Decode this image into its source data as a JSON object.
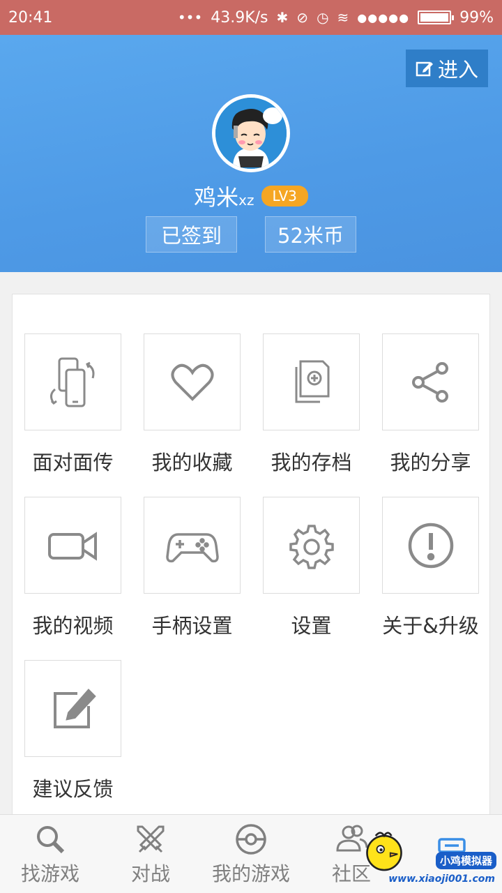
{
  "status_bar": {
    "time": "20:41",
    "more": "•••",
    "speed": "43.9K/s",
    "battery_text": "99%"
  },
  "header": {
    "enter_label": "进入",
    "username": "鸡米",
    "username_suffix": "xz",
    "level": "LV3",
    "signed_label": "已签到",
    "coins_label": "52米币"
  },
  "grid": [
    {
      "label": "面对面传",
      "icon": "phone-transfer-icon"
    },
    {
      "label": "我的收藏",
      "icon": "heart-icon"
    },
    {
      "label": "我的存档",
      "icon": "save-file-icon"
    },
    {
      "label": "我的分享",
      "icon": "share-icon"
    },
    {
      "label": "我的视频",
      "icon": "video-camera-icon"
    },
    {
      "label": "手柄设置",
      "icon": "gamepad-icon"
    },
    {
      "label": "设置",
      "icon": "gear-icon"
    },
    {
      "label": "关于&升级",
      "icon": "info-exclamation-icon"
    },
    {
      "label": "建议反馈",
      "icon": "edit-feedback-icon"
    }
  ],
  "bottom_nav": [
    {
      "label": "找游戏",
      "icon": "search-icon"
    },
    {
      "label": "对战",
      "icon": "swords-icon"
    },
    {
      "label": "我的游戏",
      "icon": "pokeball-icon"
    },
    {
      "label": "社区",
      "icon": "users-icon"
    },
    {
      "label": "",
      "icon": "server-icon"
    }
  ],
  "watermark": {
    "name": "小鸡模拟器",
    "url": "www.xiaoji001.com"
  },
  "colors": {
    "status_bar": "#c96a64",
    "header": "#4e9ae6",
    "level_badge": "#f5a623",
    "icon_gray": "#8a8a8a",
    "active_nav": "#3a8ee6"
  }
}
